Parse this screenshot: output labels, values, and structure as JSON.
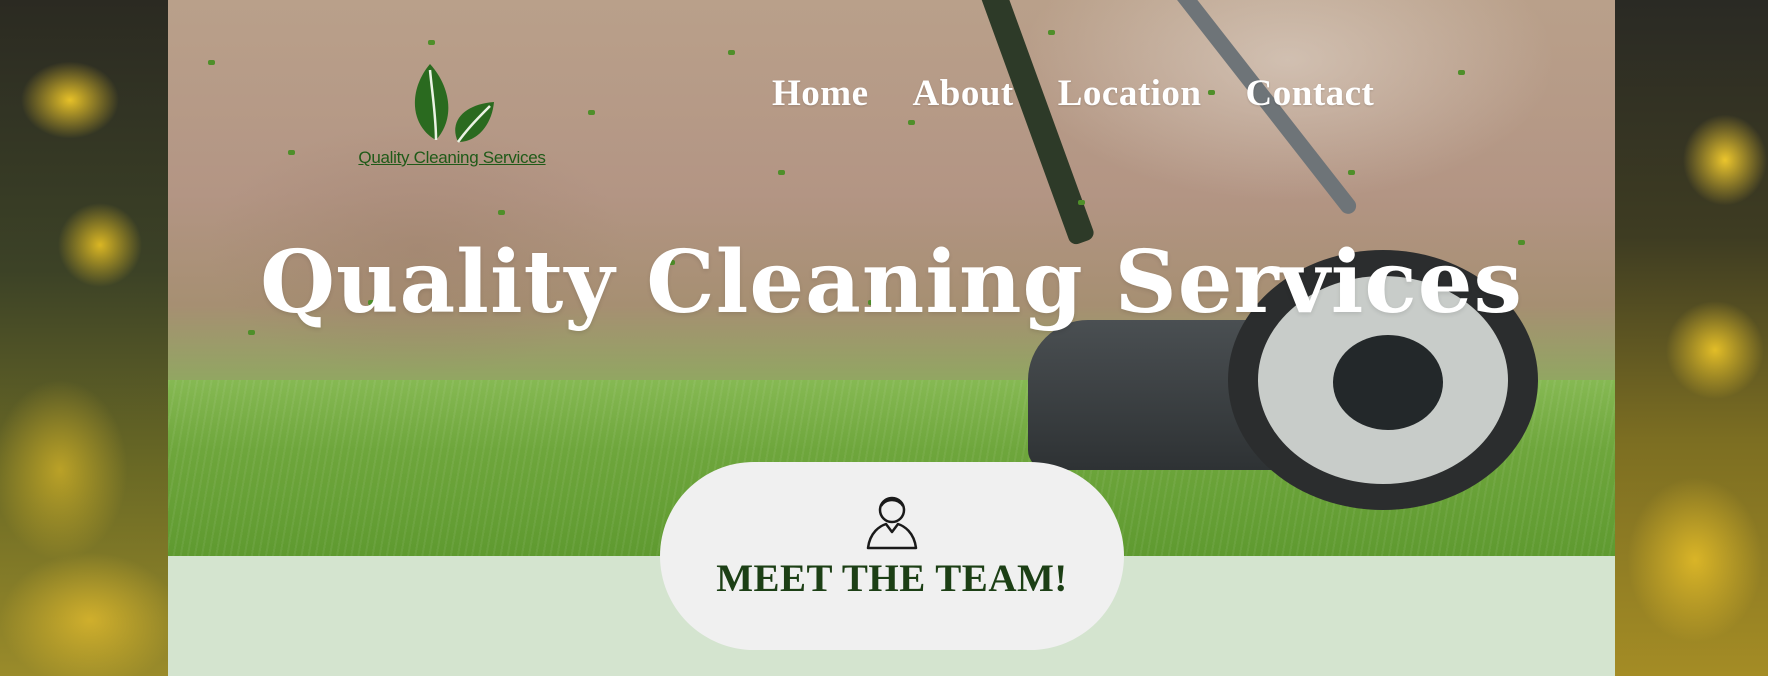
{
  "site": {
    "logo_text": "Quality Cleaning Services",
    "brand_color": "#2a6a1f"
  },
  "nav": {
    "items": [
      {
        "label": "Home"
      },
      {
        "label": "About"
      },
      {
        "label": "Location"
      },
      {
        "label": "Contact"
      }
    ]
  },
  "hero": {
    "title": "Quality Cleaning Services"
  },
  "team_button": {
    "label": "MEET THE TEAM!",
    "icon": "person-icon"
  },
  "colors": {
    "band": "#d4e4cf",
    "pill": "#f0f0f0",
    "team_text": "#1c3f15"
  }
}
